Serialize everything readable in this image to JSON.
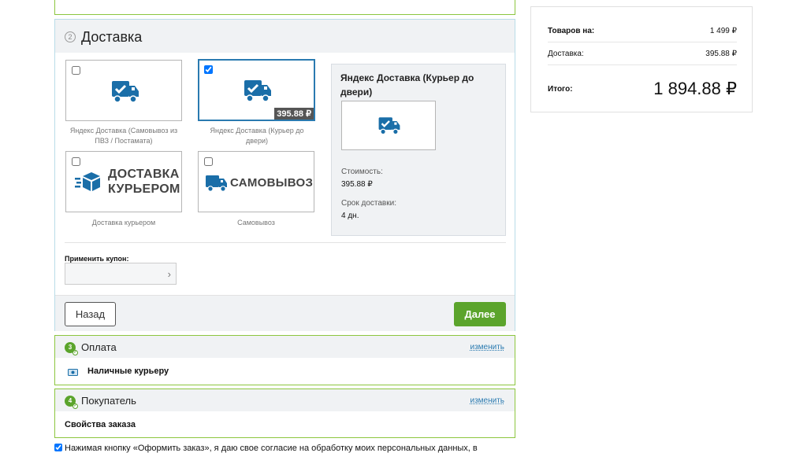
{
  "delivery": {
    "step": "2",
    "title": "Доставка",
    "options": [
      {
        "caption": "Яндекс Доставка (Самовывоз из ПВЗ / Постамата)",
        "checked": false,
        "icon": "truck-check-icon"
      },
      {
        "caption": "Яндекс Доставка (Курьер до двери)",
        "checked": true,
        "price": "395.88 ₽",
        "icon": "truck-check-icon"
      },
      {
        "caption": "Доставка курьером",
        "checked": false,
        "logo_line1": "ДОСТАВКА",
        "logo_line2": "КУРЬЕРОМ",
        "icon": "box-icon"
      },
      {
        "caption": "Самовывоз",
        "checked": false,
        "logo_text": "САМОВЫВОЗ",
        "icon": "truck-icon"
      }
    ],
    "info": {
      "title": "Яндекс Доставка (Курьер до двери)",
      "cost_label": "Стоимость:",
      "cost_value": "395.88 ₽",
      "term_label": "Срок доставки:",
      "term_value": "4 дн."
    },
    "coupon_label": "Применить купон:",
    "coupon_value": "",
    "back_label": "Назад",
    "next_label": "Далее"
  },
  "payment": {
    "step": "3",
    "title": "Оплата",
    "change_label": "изменить",
    "value": "Наличные курьеру"
  },
  "buyer": {
    "step": "4",
    "title": "Покупатель",
    "change_label": "изменить",
    "value": "Свойства заказа"
  },
  "agreement": "Нажимая кнопку «Оформить заказ», я даю свое согласие на обработку моих персональных данных, в",
  "summary": {
    "goods_label": "Товаров на:",
    "goods_value": "1 499 ₽",
    "delivery_label": "Доставка:",
    "delivery_value": "395.88 ₽",
    "total_label": "Итого:",
    "total_value": "1 894.88 ₽"
  },
  "colors": {
    "accent_green": "#5ba42c",
    "accent_blue": "#1a6ea8",
    "section_border": "#8cc63f"
  }
}
